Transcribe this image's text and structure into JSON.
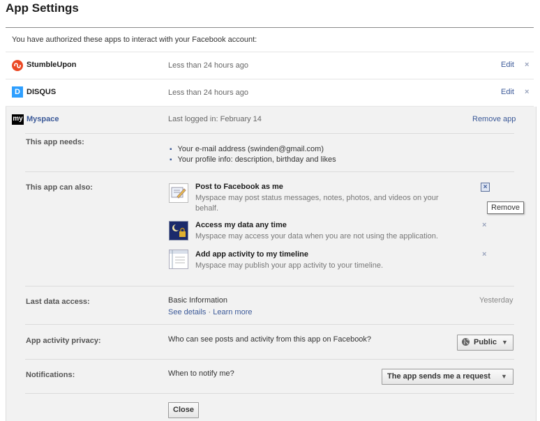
{
  "page": {
    "title": "App Settings",
    "intro": "You have authorized these apps to interact with your Facebook account:"
  },
  "apps": [
    {
      "name": "StumbleUpon",
      "time": "Less than 24 hours ago",
      "edit": "Edit",
      "remove": "×"
    },
    {
      "name": "DISQUS",
      "time": "Less than 24 hours ago",
      "edit": "Edit",
      "remove": "×",
      "icon_letter": "D"
    }
  ],
  "myspace": {
    "icon_text": "my",
    "name": "Myspace",
    "last_login": "Last logged in: February 14",
    "remove_app": "Remove app",
    "needs_label": "This app needs:",
    "needs": [
      "Your e-mail address (swinden@gmail.com)",
      "Your profile info: description, birthday and likes"
    ],
    "can_also_label": "This app can also:",
    "permissions": [
      {
        "title": "Post to Facebook as me",
        "desc": "Myspace may post status messages, notes, photos, and videos on your behalf.",
        "remove": "×"
      },
      {
        "title": "Access my data any time",
        "desc": "Myspace may access your data when you are not using the application.",
        "remove": "×"
      },
      {
        "title": "Add app activity to my timeline",
        "desc": "Myspace may publish your app activity to your timeline.",
        "remove": "×"
      }
    ],
    "tooltip": "Remove",
    "last_access_label": "Last data access:",
    "last_access_value": "Basic Information",
    "see_details": "See details",
    "dot": "·",
    "learn_more": "Learn more",
    "last_access_when": "Yesterday",
    "privacy_label": "App activity privacy:",
    "privacy_question": "Who can see posts and activity from this app on Facebook?",
    "privacy_value": "Public",
    "notif_label": "Notifications:",
    "notif_question": "When to notify me?",
    "notif_value": "The app sends me a request",
    "close": "Close"
  },
  "colors": {
    "link": "#3b5998",
    "stumble": "#eb4924",
    "disqus": "#2e9fff"
  }
}
